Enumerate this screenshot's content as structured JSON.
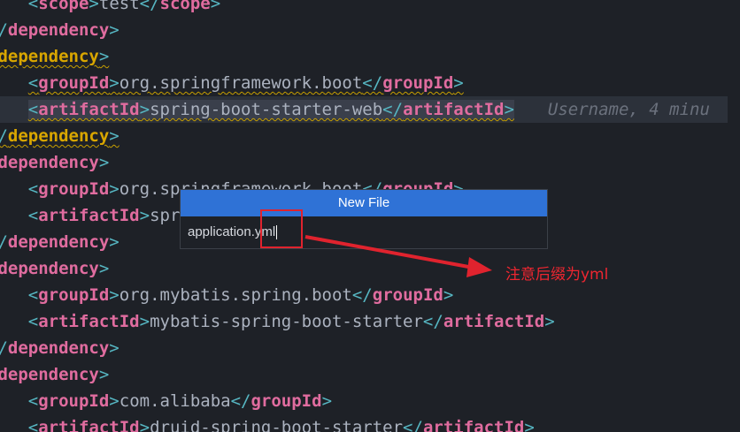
{
  "lines": [
    {
      "indent": "    ",
      "open": "scope",
      "value": "test",
      "close": "scope"
    },
    {
      "indent": "",
      "close_only": "dependency"
    },
    {
      "indent": "",
      "open_only": "dependency",
      "squiggly": true
    },
    {
      "indent": "    ",
      "open": "groupId",
      "value": "org.springframework.boot",
      "close": "groupId",
      "squiggly": true
    },
    {
      "indent": "    ",
      "open": "artifactId",
      "value": "spring-boot-starter-web",
      "close": "artifactId",
      "squiggly": true,
      "current": true
    },
    {
      "indent": "",
      "close_only": "dependency",
      "squiggly": true
    },
    {
      "indent": "",
      "open_only": "dependency"
    },
    {
      "indent": "    ",
      "open": "groupId",
      "value": "org.springframework.boot",
      "close": "groupId"
    },
    {
      "indent": "    ",
      "open": "artifactId",
      "value": "spring-boot-starter-jdbc",
      "close": "artifactId"
    },
    {
      "indent": "",
      "close_only": "dependency"
    },
    {
      "indent": "",
      "open_only": "dependency"
    },
    {
      "indent": "    ",
      "open": "groupId",
      "value": "org.mybatis.spring.boot",
      "close": "groupId"
    },
    {
      "indent": "    ",
      "open": "artifactId",
      "value": "mybatis-spring-boot-starter",
      "close": "artifactId"
    },
    {
      "indent": "",
      "close_only": "dependency"
    },
    {
      "indent": "",
      "open_only": "dependency"
    },
    {
      "indent": "    ",
      "open": "groupId",
      "value": "com.alibaba",
      "close": "groupId"
    },
    {
      "indent": "    ",
      "open": "artifactId",
      "value": "druid-spring-boot-starter",
      "close": "artifactId"
    }
  ],
  "blame": "Username, 4 minu",
  "dialog": {
    "title": "New File",
    "input_value": "application.yml"
  },
  "annotation": "注意后缀为yml",
  "colors": {
    "accent": "#2f72d6",
    "annotation_red": "#e0232e"
  }
}
